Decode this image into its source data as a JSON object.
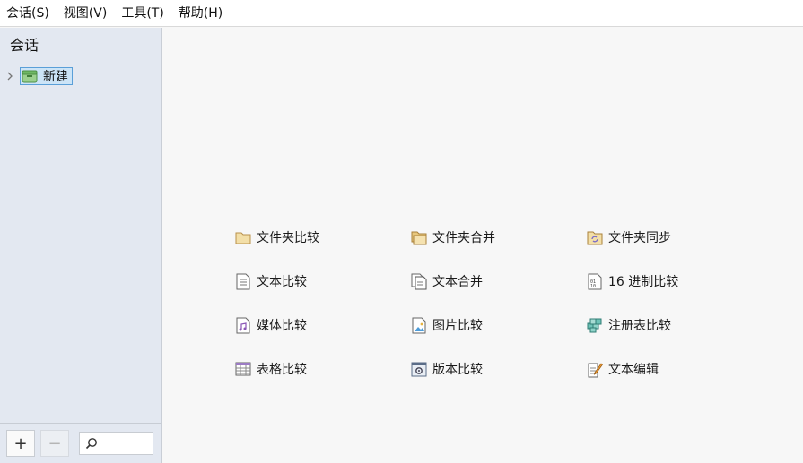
{
  "menubar": {
    "items": [
      "会话(S)",
      "视图(V)",
      "工具(T)",
      "帮助(H)"
    ]
  },
  "sidebar": {
    "title": "会话",
    "tree": {
      "node_label": "新建",
      "icon": "session-folder-icon"
    },
    "footer": {
      "add_label": "+",
      "remove_label": "−",
      "search_placeholder": ""
    }
  },
  "launcher": {
    "items": [
      {
        "label": "文件夹比较",
        "icon": "folder-compare-icon"
      },
      {
        "label": "文件夹合并",
        "icon": "folder-merge-icon"
      },
      {
        "label": "文件夹同步",
        "icon": "folder-sync-icon"
      },
      {
        "label": "文本比较",
        "icon": "text-compare-icon"
      },
      {
        "label": "文本合并",
        "icon": "text-merge-icon"
      },
      {
        "label": "16 进制比较",
        "icon": "hex-compare-icon"
      },
      {
        "label": "媒体比较",
        "icon": "media-compare-icon"
      },
      {
        "label": "图片比较",
        "icon": "picture-compare-icon"
      },
      {
        "label": "注册表比较",
        "icon": "registry-compare-icon"
      },
      {
        "label": "表格比较",
        "icon": "table-compare-icon"
      },
      {
        "label": "版本比较",
        "icon": "version-compare-icon"
      },
      {
        "label": "文本编辑",
        "icon": "text-edit-icon"
      }
    ]
  },
  "colors": {
    "sidebar_bg": "#e3e8f1",
    "main_bg": "#f7f7f7",
    "selection_bg": "#cce4f7",
    "selection_border": "#5a9fd8",
    "folder": "#e8c77d"
  }
}
